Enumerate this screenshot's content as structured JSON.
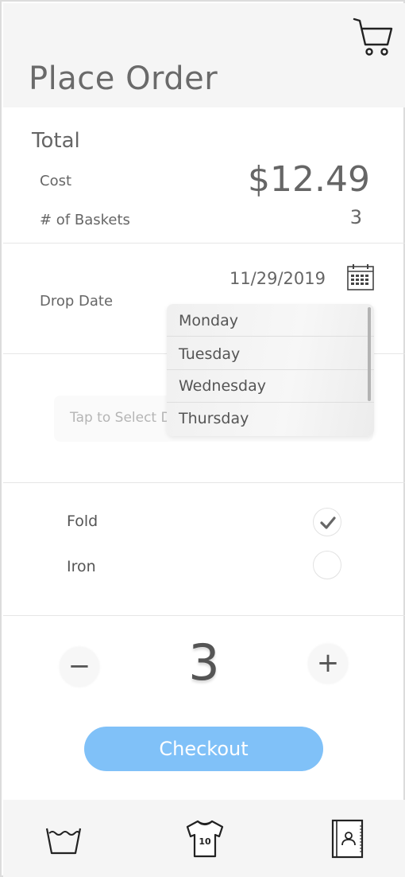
{
  "header": {
    "title": "Place Order",
    "cart_icon": "shopping-cart-icon"
  },
  "total": {
    "heading": "Total",
    "cost_label": "Cost",
    "cost_value": "$12.49",
    "baskets_label": "# of Baskets",
    "baskets_value": "3"
  },
  "drop": {
    "label": "Drop Date",
    "date": "11/29/2019",
    "calendar_icon": "calendar-icon",
    "select_placeholder": "Tap to Select D",
    "days": [
      "Monday",
      "Tuesday",
      "Wednesday",
      "Thursday"
    ]
  },
  "options": {
    "fold_label": "Fold",
    "fold_checked": true,
    "iron_label": "Iron",
    "iron_checked": false
  },
  "quantity": {
    "value": "3",
    "minus": "−",
    "plus": "+"
  },
  "checkout_label": "Checkout",
  "colors": {
    "accent": "#80c1f8",
    "header_bg": "#f5f5f5",
    "text": "#555555"
  },
  "nav": {
    "items": [
      {
        "icon": "wash-basin-icon"
      },
      {
        "icon": "jersey-icon",
        "label": "10"
      },
      {
        "icon": "contact-book-icon"
      }
    ]
  }
}
